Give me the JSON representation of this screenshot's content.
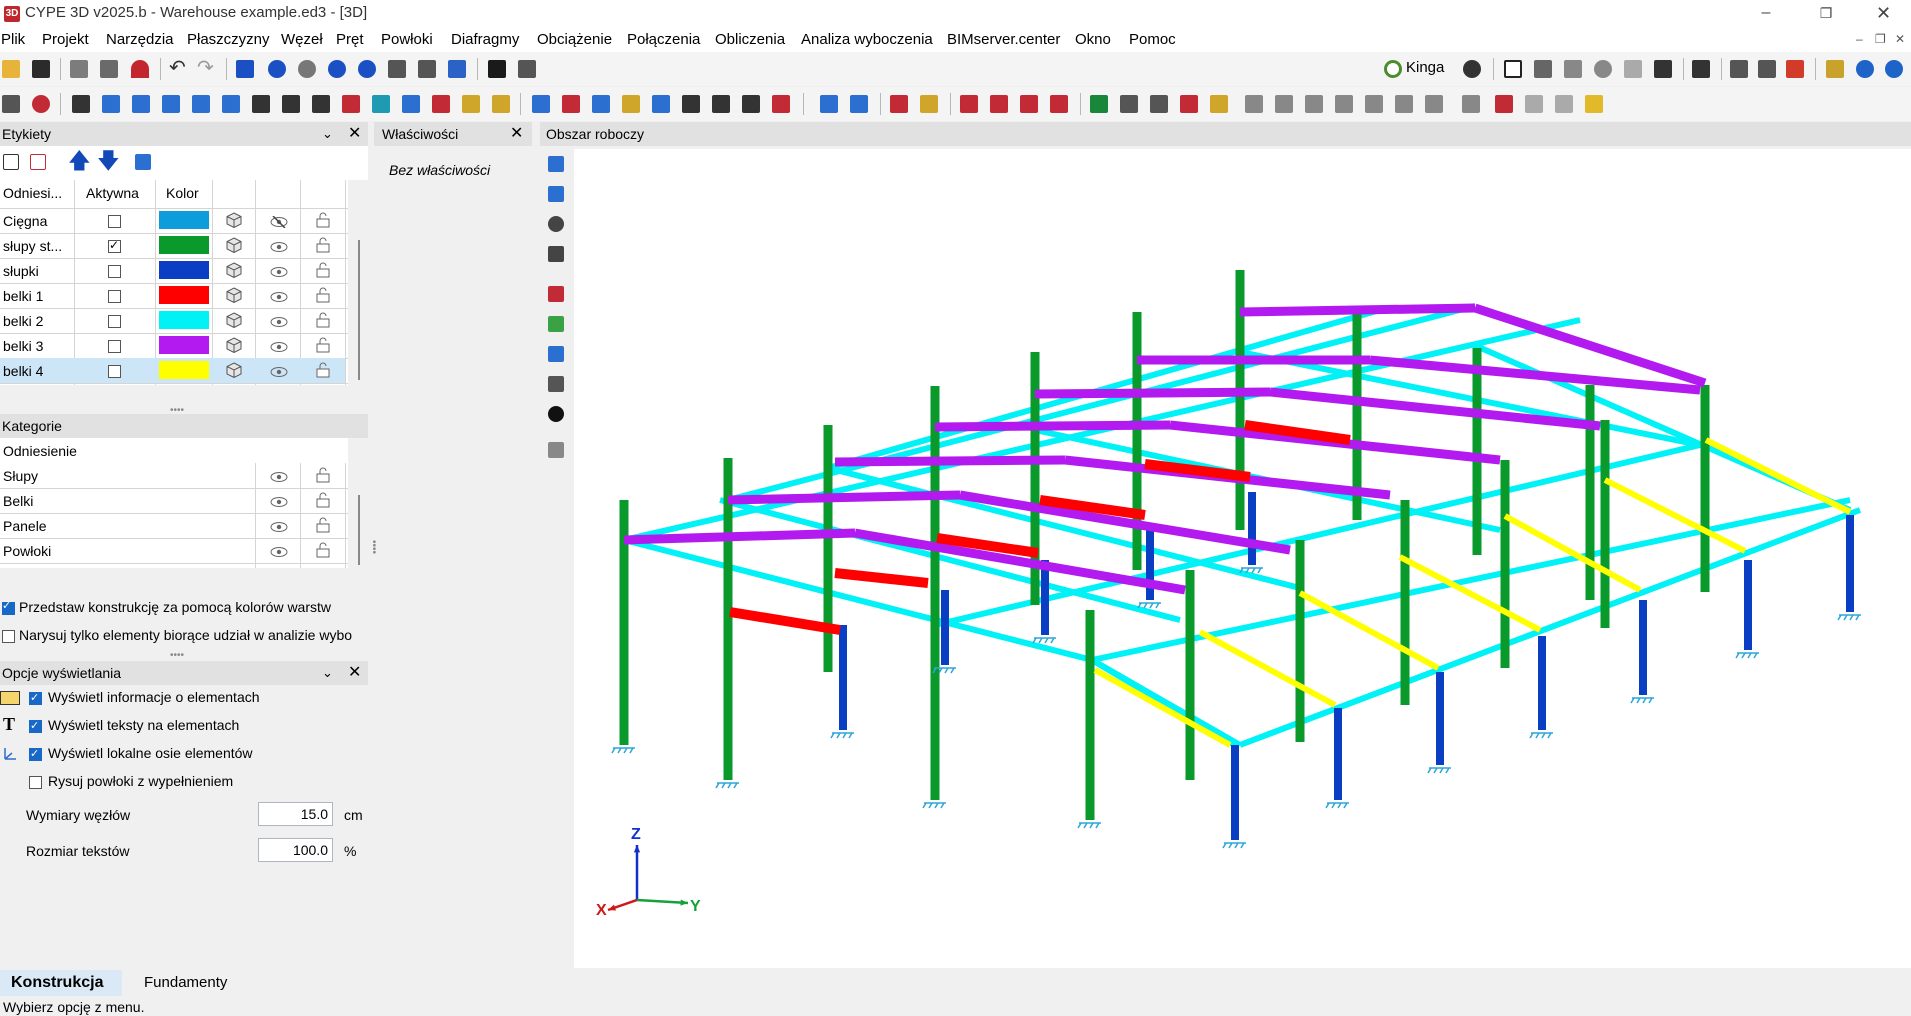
{
  "window": {
    "title": "CYPE 3D v2025.b - Warehouse example.ed3 - [3D]",
    "icon_label": "3D",
    "controls": [
      "minimize-icon",
      "maximize-icon",
      "close-icon"
    ]
  },
  "menu": [
    "Plik",
    "Projekt",
    "Narzędzia",
    "Płaszczyzny",
    "Węzeł",
    "Pręt",
    "Powłoki",
    "Diafragmy",
    "Obciążenie",
    "Połączenia",
    "Obliczenia",
    "Analiza wyboczenia",
    "BIMserver.center",
    "Okno",
    "Pomoc"
  ],
  "user": {
    "name": "Kinga"
  },
  "panels": {
    "labels": {
      "title": "Etykiety",
      "columns": [
        "Odniesi...",
        "Aktywna",
        "Kolor"
      ],
      "rows": [
        {
          "name": "Cięgna",
          "active": false,
          "color": "#0d9ddb",
          "hidden_eye": true
        },
        {
          "name": "słupy st...",
          "active": true,
          "color": "#0a9a2c",
          "hidden_eye": false
        },
        {
          "name": "słupki",
          "active": false,
          "color": "#0a3fc4",
          "hidden_eye": false
        },
        {
          "name": "belki 1",
          "active": false,
          "color": "#ff0000",
          "hidden_eye": false
        },
        {
          "name": "belki 2",
          "active": false,
          "color": "#00f2f6",
          "hidden_eye": false
        },
        {
          "name": "belki 3",
          "active": false,
          "color": "#b31af0",
          "hidden_eye": false
        },
        {
          "name": "belki 4",
          "active": false,
          "color": "#ffff00",
          "hidden_eye": false
        }
      ],
      "selected_row": 6
    },
    "properties": {
      "title": "Właściwości",
      "empty": "Bez właściwości"
    },
    "categories": {
      "title": "Kategorie",
      "header": "Odniesienie",
      "rows": [
        "Słupy",
        "Belki",
        "Panele",
        "Powłoki"
      ]
    },
    "checks": [
      {
        "label": "Przedstaw konstrukcję za pomocą kolorów warstw",
        "checked": true
      },
      {
        "label": "Narysuj tylko elementy biorące udział w analizie wybo",
        "checked": false
      }
    ],
    "display": {
      "title": "Opcje wyświetlania",
      "options": [
        {
          "label": "Wyświetl informacje o elementach",
          "checked": true
        },
        {
          "label": "Wyświetl teksty na elementach",
          "checked": true
        },
        {
          "label": "Wyświetl lokalne osie elementów",
          "checked": true
        },
        {
          "label": "Rysuj powłoki z wypełnieniem",
          "checked": false
        }
      ],
      "node_size": {
        "label": "Wymiary węzłów",
        "value": "15.0",
        "unit": "cm"
      },
      "text_size": {
        "label": "Rozmiar tekstów",
        "value": "100.0",
        "unit": "%"
      }
    },
    "workspace": {
      "title": "Obszar roboczy"
    }
  },
  "axes": {
    "z": "Z",
    "x": "X",
    "y": "Y"
  },
  "tabs": [
    "Konstrukcja",
    "Fundamenty"
  ],
  "status": "Wybierz opcję z menu."
}
